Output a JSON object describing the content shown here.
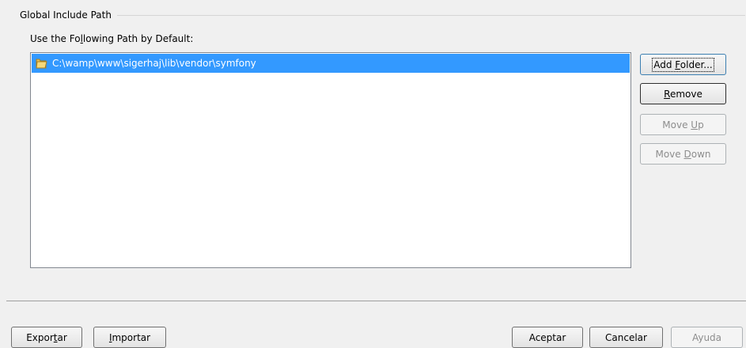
{
  "group": {
    "title": "Global Include Path",
    "label_parts": [
      "Use the Fo",
      "l",
      "lowing Path by Default:"
    ]
  },
  "path_list": {
    "items": [
      {
        "path": "C:\\wamp\\www\\sigerhaj\\lib\\vendor\\symfony",
        "icon": "folder-icon",
        "selected": true
      }
    ]
  },
  "side_buttons": {
    "add_folder": {
      "pre": "Add ",
      "key": "F",
      "post": "older..."
    },
    "remove": {
      "pre": "",
      "key": "R",
      "post": "emove"
    },
    "move_up": {
      "pre": "Move ",
      "key": "U",
      "post": "p"
    },
    "move_down": {
      "pre": "Move ",
      "key": "D",
      "post": "own"
    }
  },
  "footer": {
    "exportar": {
      "pre": "Expor",
      "key": "t",
      "post": "ar"
    },
    "importar": {
      "pre": "",
      "key": "I",
      "post": "mportar"
    },
    "aceptar": "Aceptar",
    "cancelar": "Cancelar",
    "ayuda": "Ayuda"
  },
  "colors": {
    "selection": "#3399ff",
    "window_bg": "#f0f0f0",
    "disabled_text": "#8d8d8d"
  }
}
